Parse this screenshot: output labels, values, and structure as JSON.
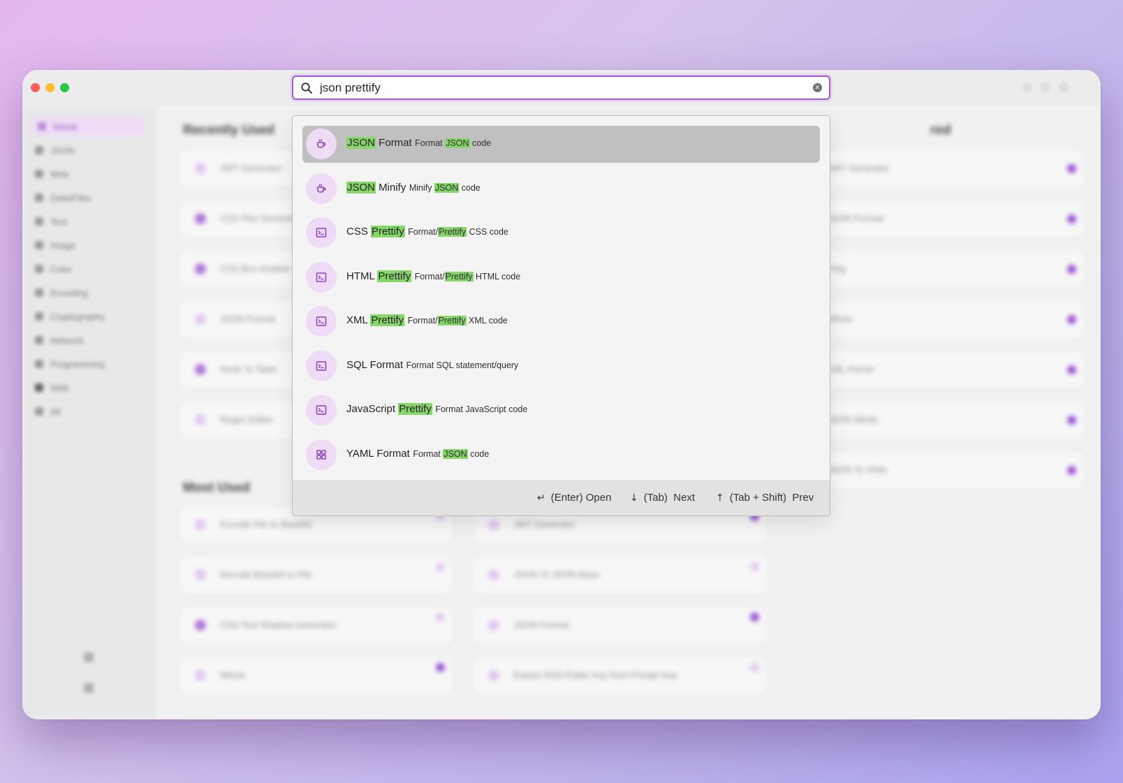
{
  "search": {
    "value": "json prettify"
  },
  "sidebar": {
    "items": [
      {
        "label": "Home"
      },
      {
        "label": "JSON"
      },
      {
        "label": "Web"
      },
      {
        "label": "Data/Files"
      },
      {
        "label": "Text"
      },
      {
        "label": "Image"
      },
      {
        "label": "Color"
      },
      {
        "label": "Encoding"
      },
      {
        "label": "Cryptography"
      },
      {
        "label": "Network"
      },
      {
        "label": "Programming"
      },
      {
        "label": "Web"
      },
      {
        "label": "All"
      }
    ]
  },
  "main": {
    "recently_used_title": "Recently Used",
    "most_used_title": "Most Used",
    "starred_title": "red",
    "recently_used": [
      "JWT Generator",
      "CSS Flex Generator",
      "CSS Box shadow",
      "JSON Format",
      "Hook To Table",
      "Regex Editor"
    ],
    "starred": [
      "JWT Generator",
      "JSON Format",
      "Ping",
      "Whois",
      "URL Parser",
      "JSON Minify",
      "JSON To Vhdx"
    ],
    "most_used_left": [
      "Encode File to Base64",
      "Decode Base64 to File",
      "CSS Text Shadow Generator",
      "Whois"
    ],
    "most_used_right": [
      "JWT Generator",
      "JSON To JSON Base",
      "JSON Format",
      "Extract RSA Public Key from Private Key"
    ]
  },
  "results": [
    {
      "icon": "coffee-cup-icon",
      "selected": true,
      "name": [
        {
          "t": "JSON",
          "h": true
        },
        {
          "t": " Format",
          "h": false
        }
      ],
      "desc": [
        {
          "t": "Format ",
          "h": false
        },
        {
          "t": "JSON",
          "h": true
        },
        {
          "t": " code",
          "h": false
        }
      ]
    },
    {
      "icon": "coffee-cup-icon",
      "selected": false,
      "name": [
        {
          "t": "JSON",
          "h": true
        },
        {
          "t": " Minify",
          "h": false
        }
      ],
      "desc": [
        {
          "t": "Minify ",
          "h": false
        },
        {
          "t": "JSON",
          "h": true
        },
        {
          "t": " code",
          "h": false
        }
      ]
    },
    {
      "icon": "terminal-icon",
      "selected": false,
      "name": [
        {
          "t": "CSS ",
          "h": false
        },
        {
          "t": "Prettify",
          "h": true
        }
      ],
      "desc": [
        {
          "t": "Format/",
          "h": false
        },
        {
          "t": "Prettify",
          "h": true
        },
        {
          "t": " CSS code",
          "h": false
        }
      ]
    },
    {
      "icon": "terminal-icon",
      "selected": false,
      "name": [
        {
          "t": "HTML ",
          "h": false
        },
        {
          "t": "Prettify",
          "h": true
        }
      ],
      "desc": [
        {
          "t": "Format/",
          "h": false
        },
        {
          "t": "Prettify",
          "h": true
        },
        {
          "t": " HTML code",
          "h": false
        }
      ]
    },
    {
      "icon": "terminal-icon",
      "selected": false,
      "name": [
        {
          "t": "XML ",
          "h": false
        },
        {
          "t": "Prettify",
          "h": true
        }
      ],
      "desc": [
        {
          "t": "Format/",
          "h": false
        },
        {
          "t": "Prettify",
          "h": true
        },
        {
          "t": " XML code",
          "h": false
        }
      ]
    },
    {
      "icon": "terminal-icon",
      "selected": false,
      "name": [
        {
          "t": "SQL Format",
          "h": false
        }
      ],
      "desc": [
        {
          "t": "Format SQL statement/query",
          "h": false
        }
      ]
    },
    {
      "icon": "terminal-icon",
      "selected": false,
      "name": [
        {
          "t": "JavaScript ",
          "h": false
        },
        {
          "t": "Prettify",
          "h": true
        }
      ],
      "desc": [
        {
          "t": "Format JavaScript code",
          "h": false
        }
      ]
    },
    {
      "icon": "grid-icon",
      "selected": false,
      "name": [
        {
          "t": "YAML Format",
          "h": false
        }
      ],
      "desc": [
        {
          "t": "Format ",
          "h": false
        },
        {
          "t": "JSON",
          "h": true
        },
        {
          "t": " code",
          "h": false
        }
      ]
    }
  ],
  "footer": {
    "open_key": "↵",
    "open_label": "(Enter) Open",
    "next_key": "↓",
    "next_label": "(Tab)  Next",
    "prev_key": "↑",
    "prev_label": "(Tab + Shift)  Prev"
  },
  "colors": {
    "accent": "#a855e6",
    "highlight": "#86d66a",
    "icon_bg": "#eedcf6"
  }
}
